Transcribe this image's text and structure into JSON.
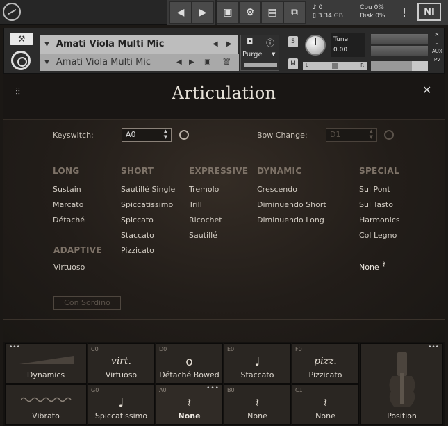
{
  "app": {
    "memory": "3.34 GB",
    "voices": "0",
    "cpu_label": "Cpu",
    "cpu_value": "0%",
    "disk_label": "Disk",
    "disk_value": "0%",
    "alert": "!",
    "ni_logo": "NI"
  },
  "instrument": {
    "name": "Amati Viola Multi Mic",
    "snapshot": "Amati Viola Multi Mic",
    "purge": "Purge",
    "tune_label": "Tune",
    "tune_value": "0.00",
    "solo": "S",
    "mute": "M",
    "pan_left": "L",
    "pan_right": "R",
    "aux": "AUX",
    "pv": "PV",
    "volume_fraction": 0.72
  },
  "panel": {
    "title": "Articulation",
    "keyswitch_label": "Keyswitch:",
    "keyswitch_value": "A0",
    "bow_change_label": "Bow Change:",
    "bow_change_value": "D1",
    "con_sordino": "Con Sordino"
  },
  "columns": {
    "long": {
      "heading": "LONG",
      "items": [
        "Sustain",
        "Marcato",
        "Détaché"
      ]
    },
    "short": {
      "heading": "SHORT",
      "items": [
        "Sautillé Single",
        "Spiccatissimo",
        "Spiccato",
        "Staccato",
        "Pizzicato"
      ]
    },
    "expressive": {
      "heading": "EXPRESSIVE",
      "items": [
        "Tremolo",
        "Trill",
        "Ricochet",
        "Sautillé"
      ]
    },
    "dynamic": {
      "heading": "DYNAMIC",
      "items": [
        "Crescendo",
        "Diminuendo Short",
        "Diminuendo Long"
      ]
    },
    "special": {
      "heading": "SPECIAL",
      "items": [
        "Sul Pont",
        "Sul Tasto",
        "Harmonics",
        "Col Legno"
      ],
      "selected": "None"
    },
    "adaptive": {
      "heading": "ADAPTIVE",
      "items": [
        "Virtuoso"
      ]
    }
  },
  "slots": {
    "dynamics": "Dynamics",
    "vibrato": "Vibrato",
    "position": "Position",
    "top": [
      {
        "note": "C0",
        "glyph": "virt.",
        "label": "Virtuoso"
      },
      {
        "note": "D0",
        "glyph": "o",
        "label": "Détaché Bowed"
      },
      {
        "note": "E0",
        "glyph": "♩",
        "label": "Staccato"
      },
      {
        "note": "F0",
        "glyph": "pizz.",
        "label": "Pizzicato"
      }
    ],
    "bottom": [
      {
        "note": "G0",
        "glyph": "♩",
        "label": "Spiccatissimo"
      },
      {
        "note": "A0",
        "glyph": "𝄽",
        "label": "None"
      },
      {
        "note": "B0",
        "glyph": "𝄽",
        "label": "None"
      },
      {
        "note": "C1",
        "glyph": "𝄽",
        "label": "None"
      }
    ]
  }
}
